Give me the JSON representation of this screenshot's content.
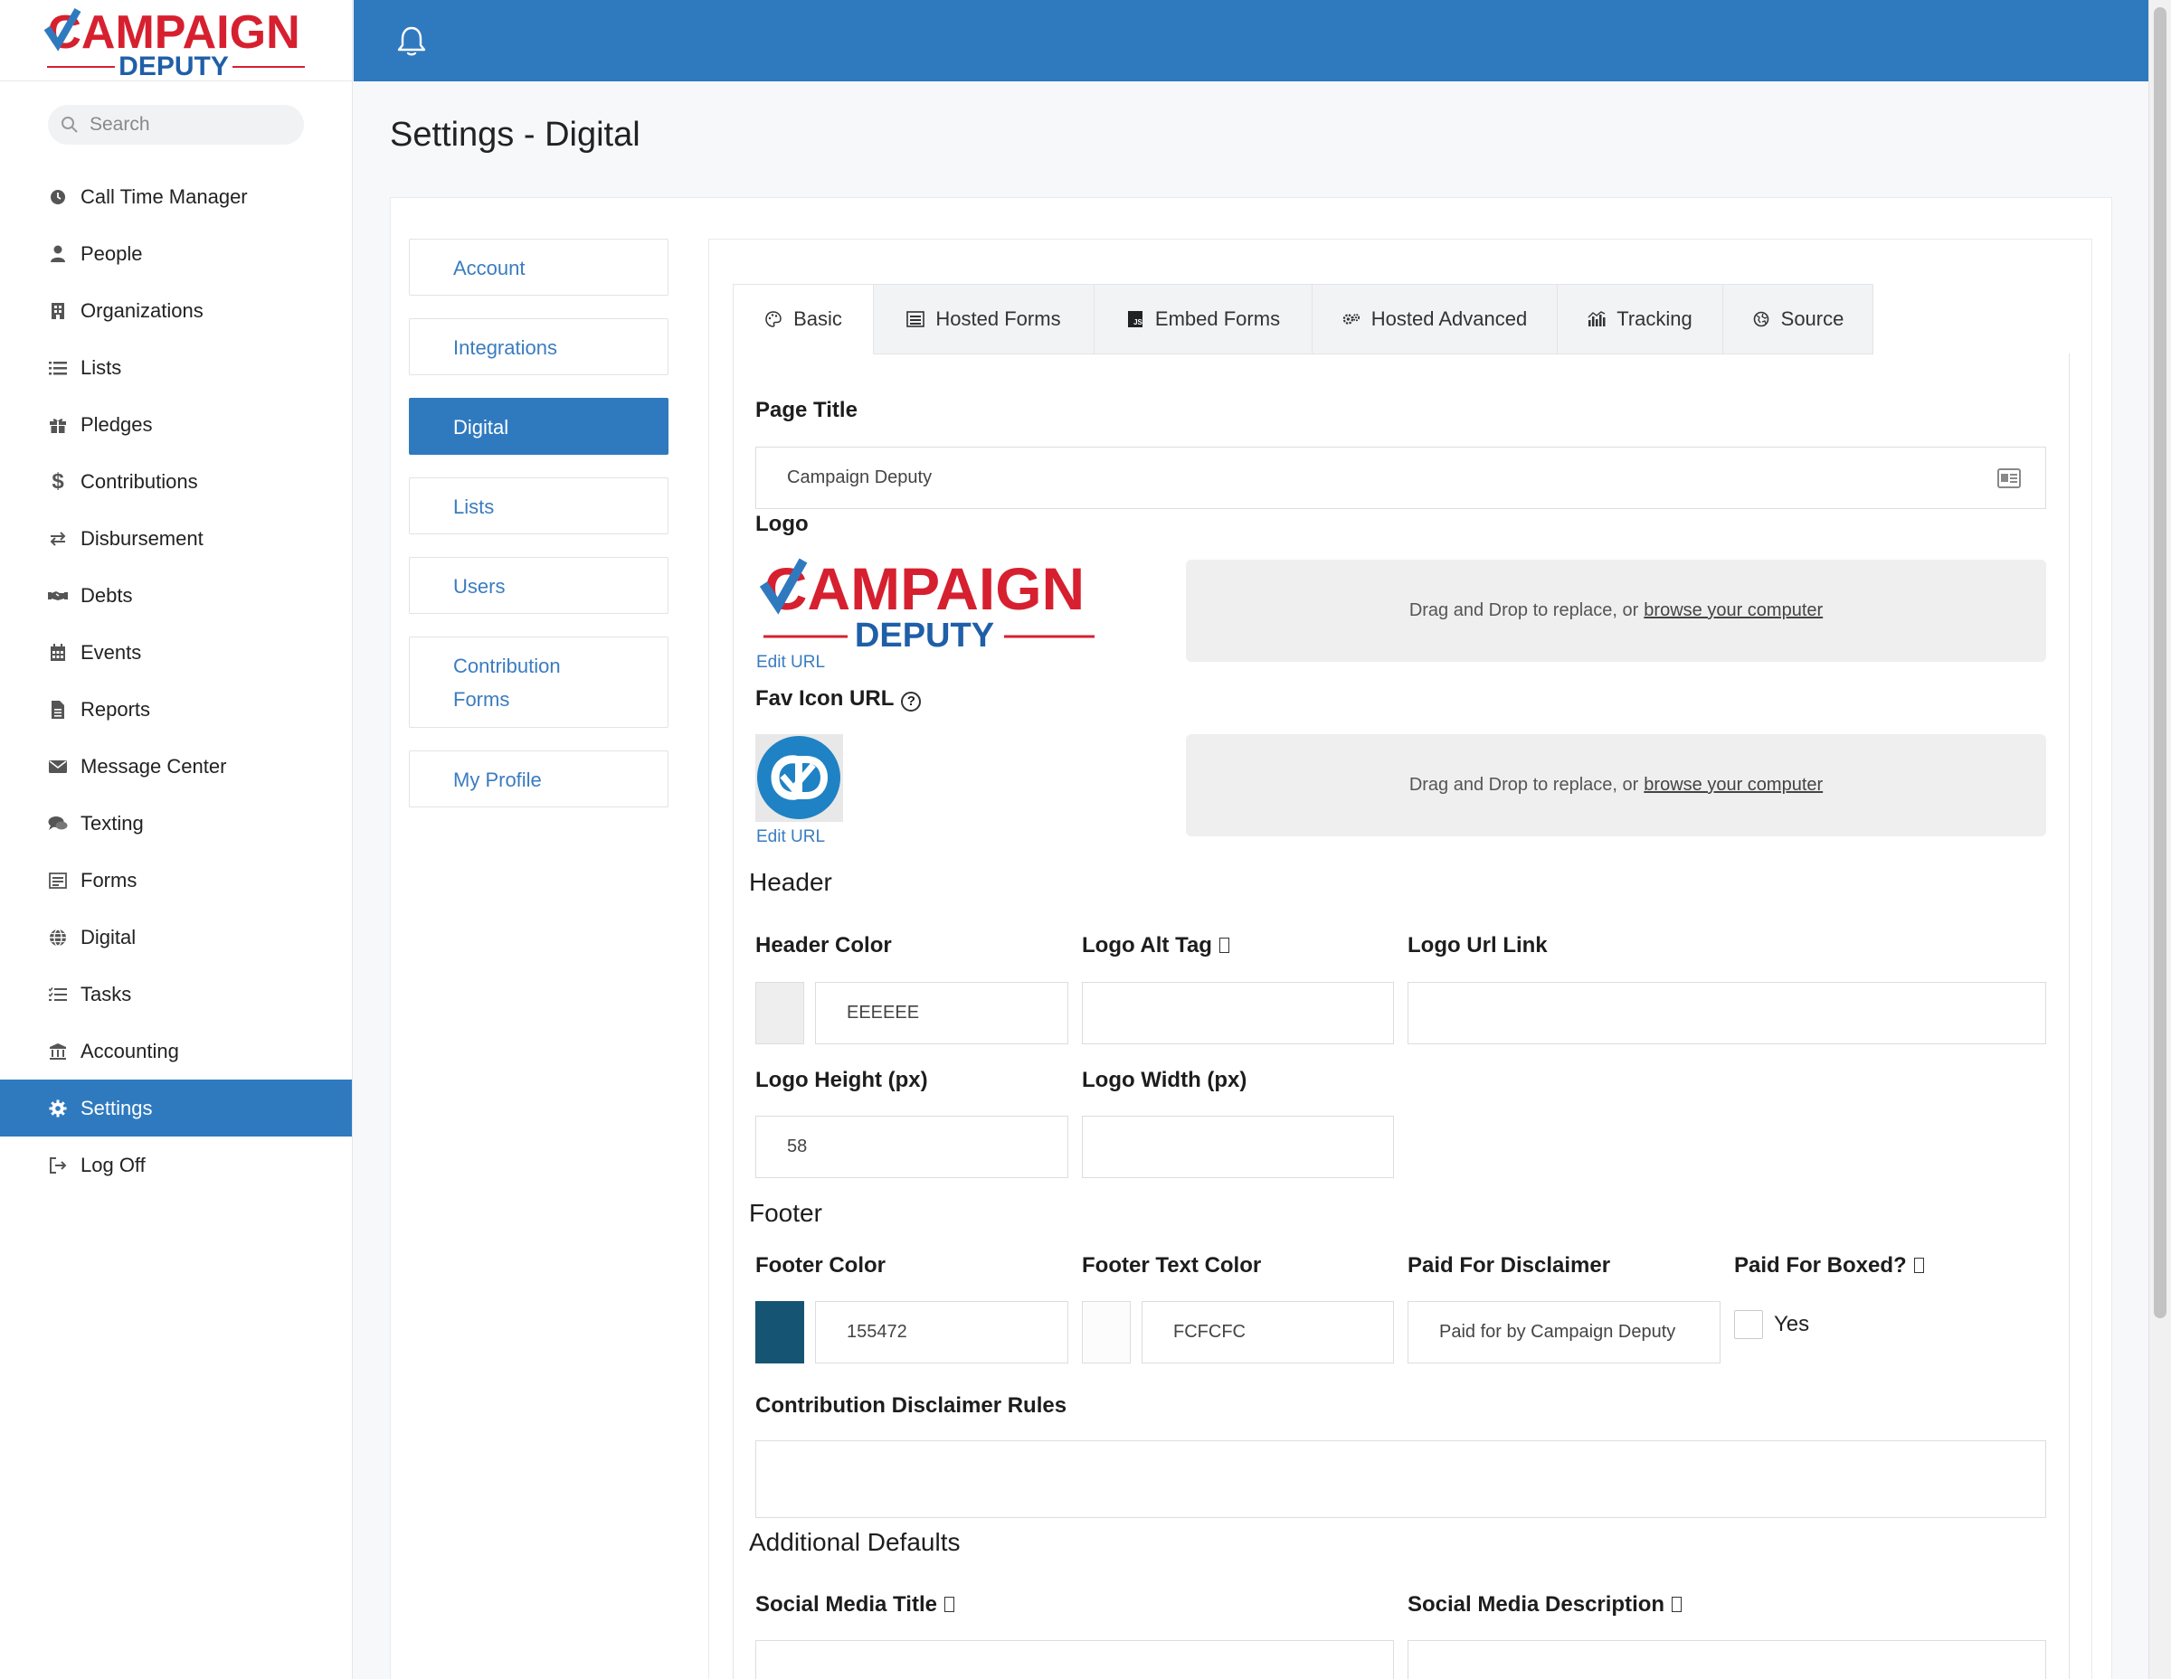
{
  "brand": {
    "name_top": "CAMPAIGN",
    "name_bottom": "DEPUTY"
  },
  "search": {
    "placeholder": "Search"
  },
  "nav": {
    "items": [
      {
        "label": "Call Time Manager",
        "icon": "clock-icon"
      },
      {
        "label": "People",
        "icon": "person-icon"
      },
      {
        "label": "Organizations",
        "icon": "building-icon"
      },
      {
        "label": "Lists",
        "icon": "list-icon"
      },
      {
        "label": "Pledges",
        "icon": "gift-icon"
      },
      {
        "label": "Contributions",
        "icon": "dollar-icon"
      },
      {
        "label": "Disbursement",
        "icon": "exchange-icon"
      },
      {
        "label": "Debts",
        "icon": "handshake-icon"
      },
      {
        "label": "Events",
        "icon": "calendar-icon"
      },
      {
        "label": "Reports",
        "icon": "file-icon"
      },
      {
        "label": "Message Center",
        "icon": "envelope-icon"
      },
      {
        "label": "Texting",
        "icon": "chat-icon"
      },
      {
        "label": "Forms",
        "icon": "form-icon"
      },
      {
        "label": "Digital",
        "icon": "globe-icon"
      },
      {
        "label": "Tasks",
        "icon": "tasks-icon"
      },
      {
        "label": "Accounting",
        "icon": "bank-icon"
      },
      {
        "label": "Settings",
        "icon": "gear-icon",
        "active": true
      },
      {
        "label": "Log Off",
        "icon": "logout-icon"
      }
    ]
  },
  "page": {
    "title": "Settings - Digital"
  },
  "settings_nav": {
    "items": [
      "Account",
      "Integrations",
      "Digital",
      "Lists",
      "Users",
      "Contribution Forms",
      "My Profile"
    ],
    "active": "Digital"
  },
  "tabs": {
    "basic": "Basic",
    "hosted_forms": "Hosted Forms",
    "embed_forms": "Embed Forms",
    "hosted_advanced": "Hosted Advanced",
    "tracking": "Tracking",
    "source": "Source",
    "active": "Basic"
  },
  "basic": {
    "page_title_label": "Page Title",
    "page_title_value": "Campaign Deputy",
    "logo_label": "Logo",
    "edit_url": "Edit URL",
    "fav_icon_label": "Fav Icon URL",
    "dropzone_text": "Drag and Drop to replace, or",
    "dropzone_link": "browse your computer",
    "header_section": "Header",
    "header_color_label": "Header Color",
    "header_color_value": "EEEEEE",
    "header_color_hex": "#EEEEEE",
    "logo_alt_tag_label": "Logo Alt Tag",
    "logo_alt_tag_value": "",
    "logo_url_link_label": "Logo Url Link",
    "logo_url_link_value": "",
    "logo_height_label": "Logo Height (px)",
    "logo_height_value": "58",
    "logo_width_label": "Logo Width (px)",
    "logo_width_value": "",
    "footer_section": "Footer",
    "footer_color_label": "Footer Color",
    "footer_color_value": "155472",
    "footer_color_hex": "#155472",
    "footer_text_color_label": "Footer Text Color",
    "footer_text_color_value": "FCFCFC",
    "footer_text_color_hex": "#FCFCFC",
    "paid_for_disclaimer_label": "Paid For Disclaimer",
    "paid_for_disclaimer_value": "Paid for by Campaign Deputy",
    "paid_for_boxed_label": "Paid For Boxed?",
    "paid_for_boxed_option": "Yes",
    "paid_for_boxed_checked": false,
    "contribution_disclaimer_label": "Contribution Disclaimer Rules",
    "contribution_disclaimer_value": "",
    "additional_defaults_section": "Additional Defaults",
    "social_media_title_label": "Social Media Title",
    "social_media_description_label": "Social Media Description"
  },
  "colors": {
    "topbar": "#2f7abf",
    "accent": "#2f7abf",
    "brand_red": "#d6202f",
    "brand_blue": "#1f5fa8"
  }
}
